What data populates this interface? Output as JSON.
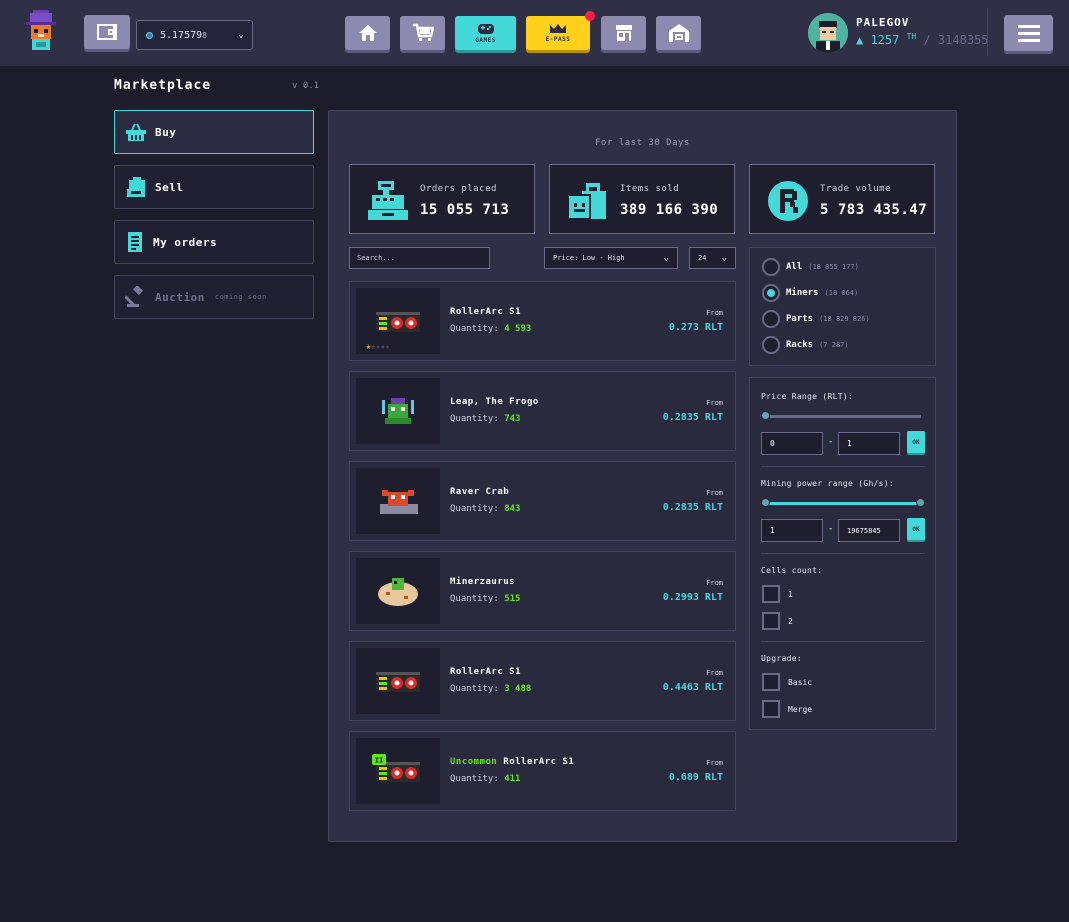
{
  "header": {
    "balance_value": "5.17579",
    "balance_tail": "8",
    "nav": [
      {
        "name": "home",
        "label": ""
      },
      {
        "name": "store",
        "label": ""
      },
      {
        "name": "games",
        "label": "GAMES"
      },
      {
        "name": "epass",
        "label": "E-PASS"
      },
      {
        "name": "market",
        "label": ""
      },
      {
        "name": "hangar",
        "label": ""
      }
    ],
    "user": {
      "name": "PALEGOV",
      "power": "1257",
      "power_unit": "TH",
      "total": "/ 3148355"
    }
  },
  "sidebar": {
    "title": "Marketplace",
    "version": "v 0.1",
    "items": [
      {
        "label": "Buy",
        "icon": "basket-icon"
      },
      {
        "label": "Sell",
        "icon": "bag-icon"
      },
      {
        "label": "My orders",
        "icon": "list-icon"
      },
      {
        "label": "Auction",
        "soon": "coming soon",
        "icon": "gavel-icon"
      }
    ]
  },
  "stats": {
    "period": "For last 30 Days",
    "cards": [
      {
        "label": "Orders placed",
        "value": "15 055 713",
        "icon": "cash-register-icon"
      },
      {
        "label": "Items sold",
        "value": "389 166 390",
        "icon": "shopping-bag-icon"
      },
      {
        "label": "Trade volume",
        "value": "5 783 435.47",
        "icon": "rlt-coin-icon"
      }
    ]
  },
  "controls": {
    "search_placeholder": "Search...",
    "sort": "Price: Low - High",
    "per_page": "24"
  },
  "items": [
    {
      "rarity": "",
      "name": "RollerArc S1",
      "qty_label": "Quantity:",
      "qty": "4 593",
      "from": "From",
      "price": "0.273 RLT",
      "stars": 1
    },
    {
      "rarity": "",
      "name": "Leap, The Frogo",
      "qty_label": "Quantity:",
      "qty": "743",
      "from": "From",
      "price": "0.2835 RLT"
    },
    {
      "rarity": "",
      "name": "Raver Crab",
      "qty_label": "Quantity:",
      "qty": "843",
      "from": "From",
      "price": "0.2835 RLT"
    },
    {
      "rarity": "",
      "name": "Minerzaurus",
      "qty_label": "Quantity:",
      "qty": "515",
      "from": "From",
      "price": "0.2993 RLT"
    },
    {
      "rarity": "",
      "name": "RollerArc S1",
      "qty_label": "Quantity:",
      "qty": "3 488",
      "from": "From",
      "price": "0.4463 RLT"
    },
    {
      "rarity": "Uncommon",
      "name": "RollerArc S1",
      "qty_label": "Quantity:",
      "qty": "411",
      "from": "From",
      "price": "0.689 RLT",
      "badge": "II"
    }
  ],
  "filters": {
    "categories": [
      {
        "label": "All",
        "count": "(18 855 177)",
        "selected": false
      },
      {
        "label": "Miners",
        "count": "(18 064)",
        "selected": true
      },
      {
        "label": "Parts",
        "count": "(18 829 826)",
        "selected": false
      },
      {
        "label": "Racks",
        "count": "(7 287)",
        "selected": false
      }
    ],
    "price_range": {
      "title": "Price Range (RLT):",
      "min": "0",
      "max": "1",
      "ok": "OK"
    },
    "power_range": {
      "title": "Mining power range (Gh/s):",
      "min": "1",
      "max": "19675845",
      "ok": "OK"
    },
    "cells": {
      "title": "Cells count:",
      "options": [
        "1",
        "2"
      ]
    },
    "upgrade": {
      "title": "Upgrade:",
      "options": [
        "Basic",
        "Merge"
      ]
    }
  },
  "colors": {
    "accent": "#43d9d8",
    "rarity_green": "#5ee81a",
    "epass": "#ffd11a",
    "notification": "#ff1c4d"
  }
}
